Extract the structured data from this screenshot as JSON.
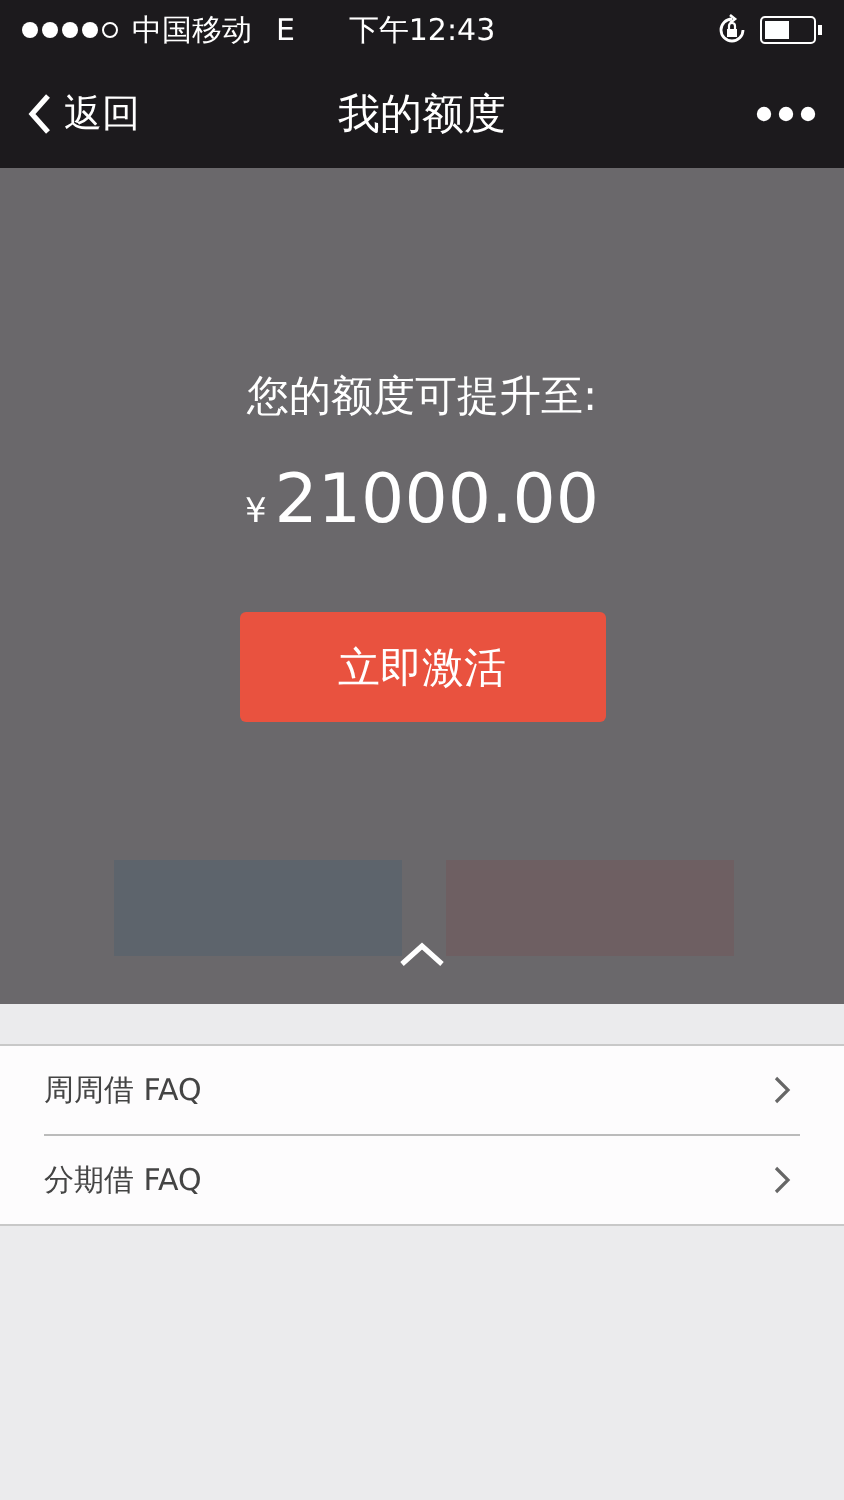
{
  "status_bar": {
    "carrier": "中国移动",
    "network": "E",
    "time": "下午12:43"
  },
  "nav_bar": {
    "back": "返回",
    "title": "我的额度"
  },
  "promo": {
    "heading": "您的额度可提升至:",
    "currency": "¥",
    "amount": "21000.00",
    "button": "立即激活"
  },
  "faq_items": [
    {
      "label": "周周借 FAQ"
    },
    {
      "label": "分期借 FAQ"
    }
  ]
}
